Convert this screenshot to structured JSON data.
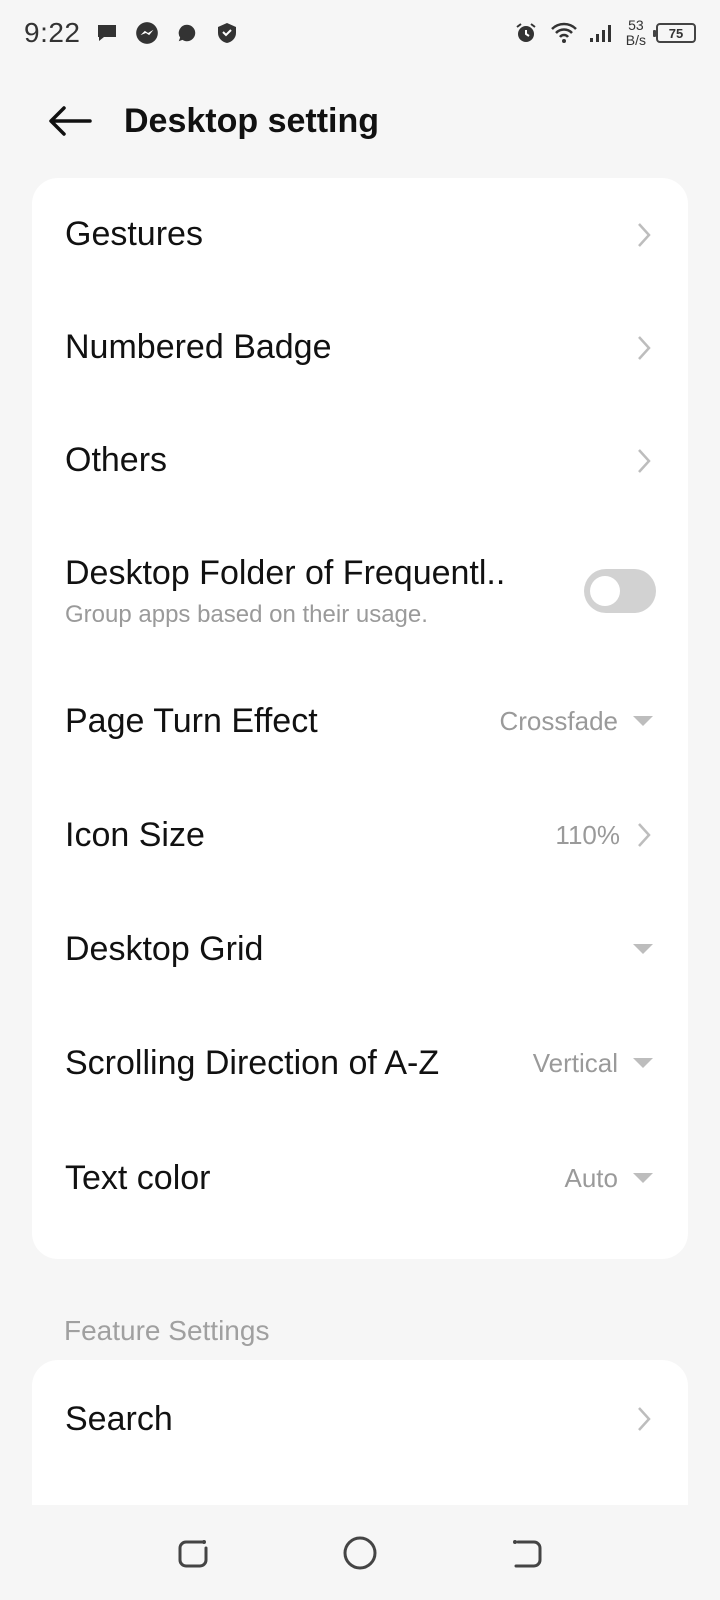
{
  "status_bar": {
    "time": "9:22",
    "net_speed_value": "53",
    "net_speed_unit": "B/s",
    "battery": "75"
  },
  "header": {
    "title": "Desktop setting"
  },
  "main_card": {
    "gestures": {
      "label": "Gestures"
    },
    "numbered_badge": {
      "label": "Numbered Badge"
    },
    "others": {
      "label": "Others"
    },
    "desktop_folder": {
      "label": "Desktop Folder of Frequentl..",
      "subtitle": "Group apps based on their usage.",
      "enabled": false
    },
    "page_turn": {
      "label": "Page Turn Effect",
      "value": "Crossfade"
    },
    "icon_size": {
      "label": "Icon Size",
      "value": "110%"
    },
    "desktop_grid": {
      "label": "Desktop Grid"
    },
    "scrolling": {
      "label": "Scrolling Direction of A-Z",
      "value": "Vertical"
    },
    "text_color": {
      "label": "Text color",
      "value": "Auto"
    }
  },
  "feature_section": {
    "title": "Feature Settings",
    "search": {
      "label": "Search"
    }
  },
  "colors": {
    "background": "#f6f6f6",
    "card": "#ffffff",
    "secondary_text": "#9a9a9a",
    "toggle_off": "#d2d2d2"
  }
}
